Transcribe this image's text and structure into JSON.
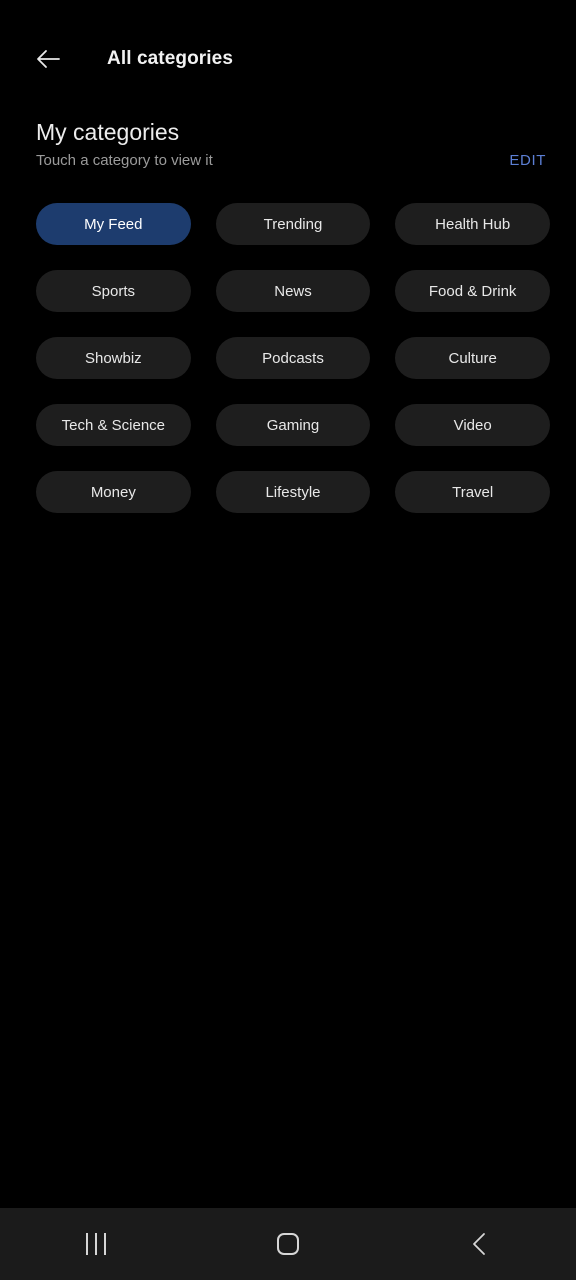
{
  "appbar": {
    "back_icon": "arrow-left-icon",
    "title": "All categories"
  },
  "section": {
    "title": "My categories",
    "subtitle": "Touch a category to view it",
    "edit_label": "EDIT",
    "edit_color": "#5c7fd4"
  },
  "categories": [
    {
      "label": "My Feed",
      "selected": true
    },
    {
      "label": "Trending",
      "selected": false
    },
    {
      "label": "Health Hub",
      "selected": false
    },
    {
      "label": "Sports",
      "selected": false
    },
    {
      "label": "News",
      "selected": false
    },
    {
      "label": "Food & Drink",
      "selected": false
    },
    {
      "label": "Showbiz",
      "selected": false
    },
    {
      "label": "Podcasts",
      "selected": false
    },
    {
      "label": "Culture",
      "selected": false
    },
    {
      "label": "Tech & Science",
      "selected": false
    },
    {
      "label": "Gaming",
      "selected": false
    },
    {
      "label": "Video",
      "selected": false
    },
    {
      "label": "Money",
      "selected": false
    },
    {
      "label": "Lifestyle",
      "selected": false
    },
    {
      "label": "Travel",
      "selected": false
    }
  ],
  "colors": {
    "background": "#000000",
    "chip_background": "#1e1e1e",
    "chip_selected_background": "#1d3c6e",
    "navbar_background": "#1b1b1b"
  },
  "navbar": {
    "recents_icon": "recents-icon",
    "home_icon": "home-icon",
    "back_icon": "chevron-left-icon"
  }
}
